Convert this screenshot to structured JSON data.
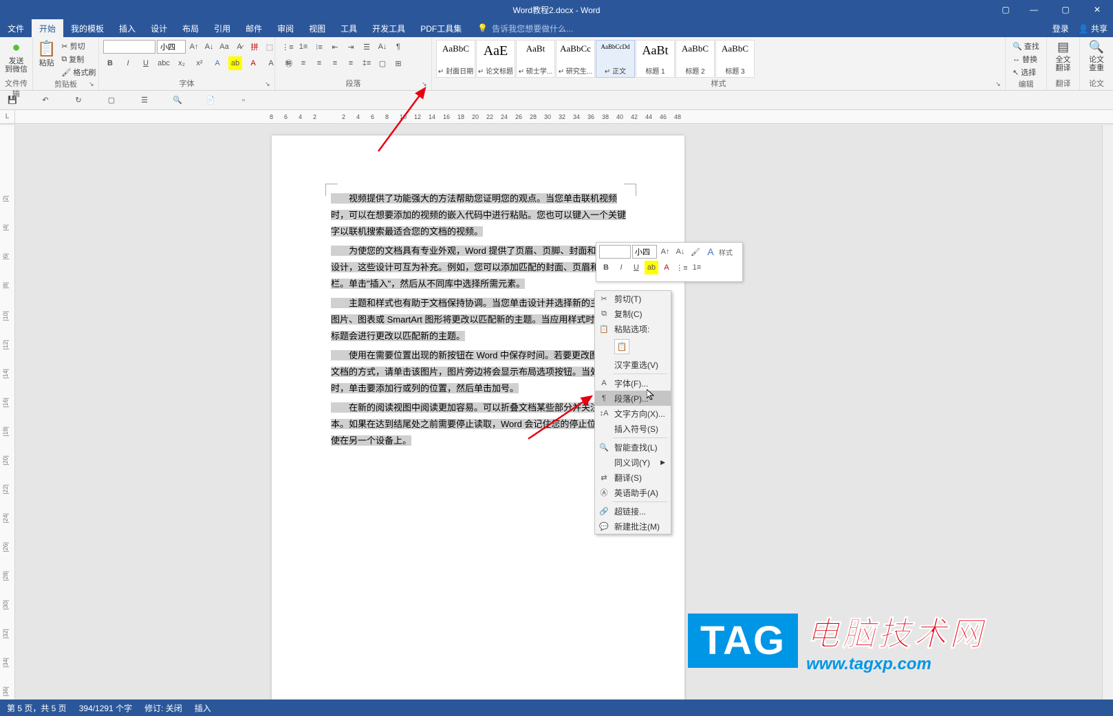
{
  "title": "Word教程2.docx - Word",
  "window": {
    "login": "登录",
    "share": "共享"
  },
  "menu": {
    "file": "文件",
    "home": "开始",
    "template": "我的模板",
    "insert": "插入",
    "design": "设计",
    "layout": "布局",
    "reference": "引用",
    "mail": "邮件",
    "review": "审阅",
    "view": "视图",
    "tools": "工具",
    "dev": "开发工具",
    "pdf": "PDF工具集",
    "tellme": "告诉我您想要做什么..."
  },
  "ribbon": {
    "wechat": {
      "label": "发送\n到微信",
      "group": "文件传输"
    },
    "clipboard": {
      "paste": "粘贴",
      "cut": "剪切",
      "copy": "复制",
      "format": "格式刷",
      "group": "剪贴板"
    },
    "font": {
      "name": "",
      "size": "小四",
      "group": "字体"
    },
    "para": {
      "group": "段落"
    },
    "styles": {
      "group": "样式",
      "items": [
        {
          "preview": "AaBbC",
          "name": "↵ 封面日期"
        },
        {
          "preview": "AaE",
          "name": "↵ 论文标题"
        },
        {
          "preview": "AaBt",
          "name": "↵ 硕士学..."
        },
        {
          "preview": "AaBbCc",
          "name": "↵ 研究生..."
        },
        {
          "preview": "AaBbCcDd",
          "name": "↵ 正文",
          "sel": true
        },
        {
          "preview": "AaBt",
          "name": "标题 1"
        },
        {
          "preview": "AaBbC",
          "name": "标题 2"
        },
        {
          "preview": "AaBbC",
          "name": "标题 3"
        }
      ]
    },
    "edit": {
      "find": "查找",
      "replace": "替换",
      "select": "选择",
      "group": "编辑"
    },
    "translate": {
      "label": "全文\n翻译",
      "group": "翻译"
    },
    "dup": {
      "label": "论文\n查重",
      "group": "论文"
    }
  },
  "ruler": {
    "corner": "L"
  },
  "doc": {
    "p1": "视频提供了功能强大的方法帮助您证明您的观点。当您单击联机视频时，可以在想要添加的视频的嵌入代码中进行粘贴。您也可以键入一个关键字以联机搜索最适合您的文档的视频。",
    "p2": "为使您的文档具有专业外观，Word 提供了页眉、页脚、封面和文本框设计，这些设计可互为补充。例如，您可以添加匹配的封面、页眉和提要栏。单击\"插入\"，然后从不同库中选择所需元素。",
    "p3": "主题和样式也有助于文档保持协调。当您单击设计并选择新的主题时，图片、图表或 SmartArt 图形将更改以匹配新的主题。当应用样式时，您的标题会进行更改以匹配新的主题。",
    "p4": "使用在需要位置出现的新按钮在 Word 中保存时间。若要更改图片适应文档的方式，请单击该图片，图片旁边将会显示布局选项按钮。当处理表格时，单击要添加行或列的位置，然后单击加号。",
    "p5": "在新的阅读视图中阅读更加容易。可以折叠文档某些部分并关注所需文本。如果在达到结尾处之前需要停止读取，Word 会记住您的停止位置 - 即使在另一个设备上。"
  },
  "ctx": {
    "cut": "剪切(T)",
    "copy": "复制(C)",
    "paste_label": "粘贴选项:",
    "reselect": "汉字重选(V)",
    "font": "字体(F)...",
    "para": "段落(P)...",
    "textdir": "文字方向(X)...",
    "symbol": "插入符号(S)",
    "smartlookup": "智能查找(L)",
    "synonym": "同义词(Y)",
    "translate": "翻译(S)",
    "english": "英语助手(A)",
    "link": "超链接...",
    "comment": "新建批注(M)"
  },
  "mini": {
    "size": "小四",
    "styles": "样式"
  },
  "status": {
    "page": "第 5 页，共 5 页",
    "words": "394/1291 个字",
    "track": "修订: 关闭",
    "insert": "插入"
  },
  "tag": {
    "box": "TAG",
    "cn": "电脑技术网",
    "url": "www.tagxp.com"
  }
}
